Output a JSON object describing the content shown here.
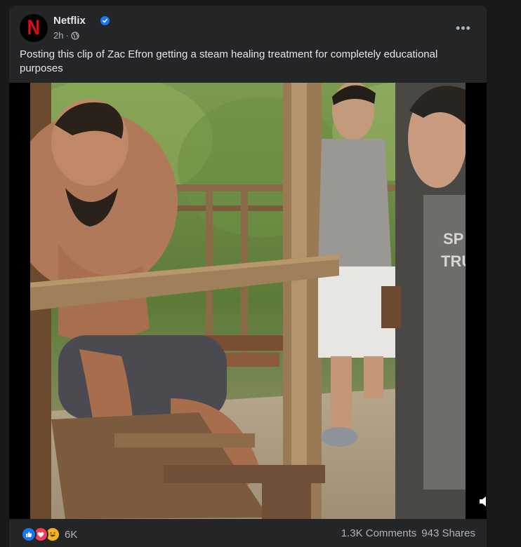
{
  "post": {
    "page_name": "Netflix",
    "avatar_letter": "N",
    "time": "2h",
    "audience_icon": "globe-icon",
    "caption": "Posting this clip of Zac Efron getting a steam healing treatment for completely educational purposes",
    "more_icon": "•••",
    "colors": {
      "brand_red": "#e50914",
      "verified_blue": "#1877f2",
      "card_bg": "#242526",
      "page_bg": "#18191a"
    }
  },
  "video": {
    "description_alt": "Video frame",
    "mute_icon": "speaker-muted-icon"
  },
  "footer": {
    "reactions": [
      "like-icon",
      "love-icon",
      "haha-icon"
    ],
    "reaction_count": "6K",
    "comments": "1.3K Comments",
    "shares": "943 Shares"
  }
}
